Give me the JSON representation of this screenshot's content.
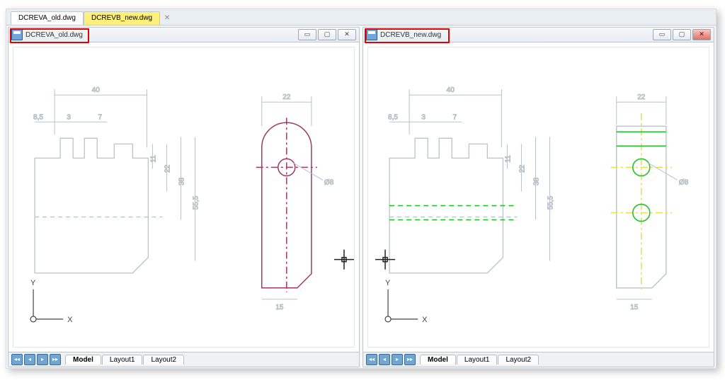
{
  "doc_tabs": {
    "tab1": "DCREVA_old.dwg",
    "tab2": "DCREVB_new.dwg",
    "close": "✕"
  },
  "left_pane": {
    "title": "DCREVA_old.dwg",
    "min": "▭",
    "max": "▢",
    "close": "✕"
  },
  "right_pane": {
    "title": "DCREVB_new.dwg",
    "min": "▭",
    "max": "▢",
    "close": "✕"
  },
  "layout_tabs": {
    "nav1": "◂◂",
    "nav2": "◂",
    "nav3": "▸",
    "nav4": "▸▸",
    "model": "Model",
    "layout1": "Layout1",
    "layout2": "Layout2"
  },
  "axes": {
    "y": "Y",
    "x": "X"
  },
  "dims": {
    "d40": "40",
    "d8_5": "8,5",
    "d3": "3",
    "d7": "7",
    "d11": "11",
    "d22v": "22",
    "d38": "38",
    "d55_5": "55,5",
    "d22top": "22",
    "dia8": "Ø8",
    "d15": "15"
  }
}
